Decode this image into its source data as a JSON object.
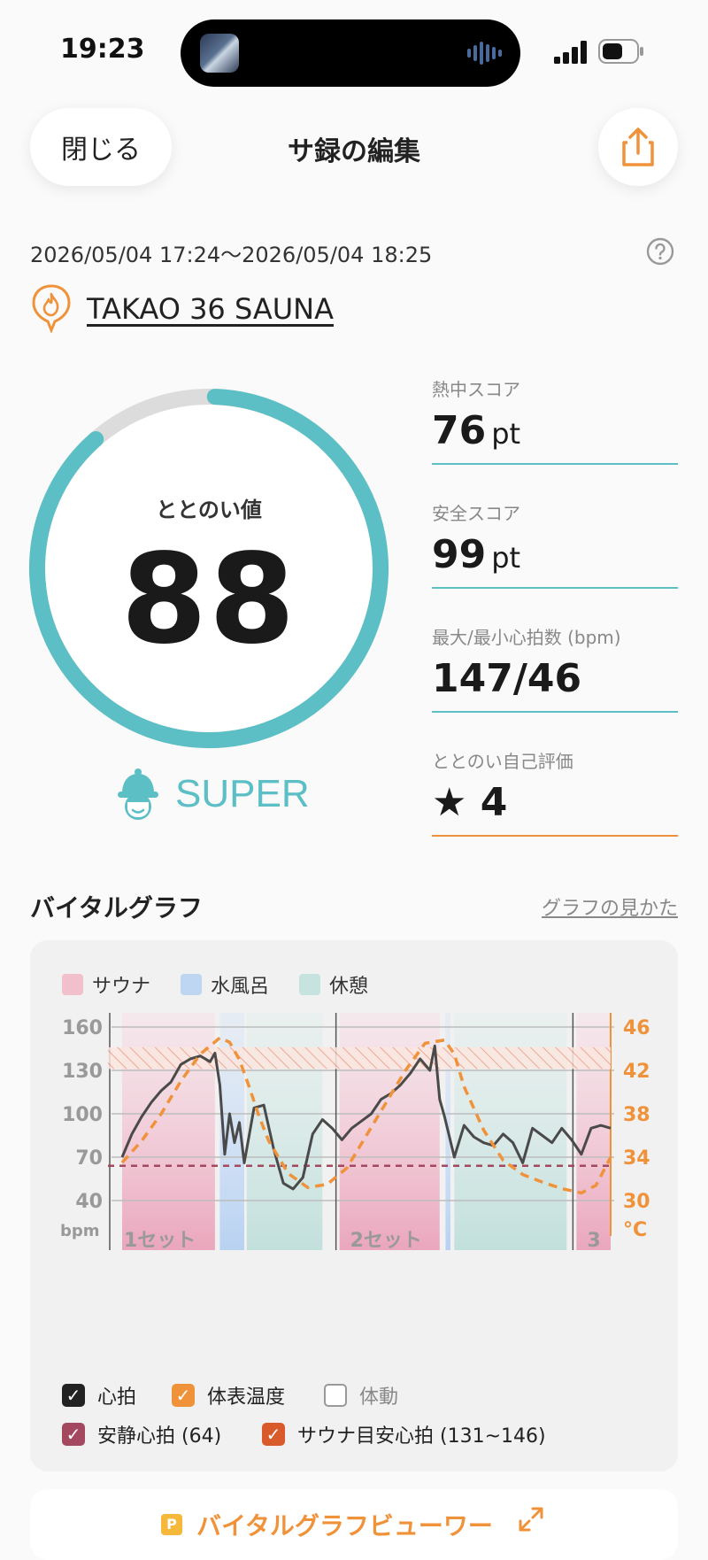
{
  "status_bar": {
    "time": "19:23"
  },
  "header": {
    "close_label": "閉じる",
    "title": "サ録の編集"
  },
  "session": {
    "datetime": "2026/05/04 17:24～2026/05/04 18:25",
    "location": "TAKAO 36 SAUNA"
  },
  "totonoi": {
    "label": "ととのい値",
    "value": "88",
    "rank": "SUPER",
    "gauge_fraction": 0.88
  },
  "metrics": [
    {
      "label": "熱中スコア",
      "value": "76",
      "unit": "pt"
    },
    {
      "label": "安全スコア",
      "value": "99",
      "unit": "pt"
    },
    {
      "label": "最大/最小心拍数 (bpm)",
      "value": "147/46",
      "unit": ""
    },
    {
      "label": "ととのい自己評価",
      "value": "★ 4",
      "unit": ""
    }
  ],
  "graph": {
    "title": "バイタルグラフ",
    "help_link": "グラフの見かた",
    "legend": [
      {
        "label": "サウナ",
        "color": "#f2bfcd"
      },
      {
        "label": "水風呂",
        "color": "#bfd6f2"
      },
      {
        "label": "休憩",
        "color": "#c6e3df"
      }
    ],
    "checkboxes": [
      {
        "label": "心拍",
        "checked": true,
        "color": "#222222"
      },
      {
        "label": "体表温度",
        "checked": true,
        "color": "#f0923a"
      },
      {
        "label": "体動",
        "checked": false,
        "color": "#999999"
      },
      {
        "label": "安静心拍 (64)",
        "checked": true,
        "color": "#a3485e"
      },
      {
        "label": "サウナ目安心拍 (131~146)",
        "checked": true,
        "color": "#d95b2b"
      }
    ]
  },
  "chart_data": {
    "type": "line",
    "y_left": {
      "ticks": [
        "160",
        "130",
        "100",
        "70",
        "40"
      ],
      "unit": "bpm",
      "range": [
        40,
        160
      ]
    },
    "y_right": {
      "ticks": [
        "46",
        "42",
        "38",
        "34",
        "30"
      ],
      "unit": "°C",
      "range": [
        30,
        46
      ]
    },
    "set_labels": [
      "1セット",
      "2セット",
      "3"
    ],
    "resting_hr": 64,
    "sauna_target_hr": [
      131,
      146
    ],
    "phases": [
      {
        "type": "sauna",
        "start": 0,
        "end": 0.19
      },
      {
        "type": "cold",
        "start": 0.2,
        "end": 0.25
      },
      {
        "type": "rest",
        "start": 0.255,
        "end": 0.41
      },
      {
        "type": "sauna",
        "start": 0.445,
        "end": 0.65
      },
      {
        "type": "cold",
        "start": 0.662,
        "end": 0.672
      },
      {
        "type": "rest",
        "start": 0.68,
        "end": 0.91
      },
      {
        "type": "sauna",
        "start": 0.93,
        "end": 1.0
      }
    ],
    "series": [
      {
        "name": "心拍",
        "x": [
          0,
          0.02,
          0.04,
          0.06,
          0.08,
          0.1,
          0.12,
          0.14,
          0.16,
          0.18,
          0.19,
          0.2,
          0.21,
          0.22,
          0.23,
          0.24,
          0.25,
          0.27,
          0.29,
          0.31,
          0.33,
          0.35,
          0.37,
          0.39,
          0.41,
          0.43,
          0.45,
          0.47,
          0.49,
          0.51,
          0.53,
          0.55,
          0.57,
          0.59,
          0.61,
          0.63,
          0.64,
          0.65,
          0.66,
          0.67,
          0.68,
          0.7,
          0.72,
          0.74,
          0.76,
          0.78,
          0.8,
          0.82,
          0.84,
          0.86,
          0.88,
          0.9,
          0.92,
          0.94,
          0.96,
          0.98,
          1.0
        ],
        "values": [
          70,
          86,
          98,
          108,
          116,
          122,
          134,
          138,
          140,
          136,
          142,
          120,
          72,
          100,
          80,
          94,
          66,
          104,
          106,
          76,
          52,
          48,
          56,
          86,
          96,
          90,
          82,
          90,
          95,
          100,
          110,
          114,
          120,
          128,
          138,
          130,
          147,
          110,
          98,
          84,
          70,
          92,
          84,
          80,
          78,
          86,
          80,
          66,
          90,
          85,
          80,
          90,
          82,
          72,
          90,
          92,
          90
        ]
      },
      {
        "name": "体表温度",
        "x": [
          0,
          0.04,
          0.08,
          0.12,
          0.16,
          0.2,
          0.22,
          0.24,
          0.26,
          0.28,
          0.3,
          0.34,
          0.38,
          0.42,
          0.46,
          0.5,
          0.54,
          0.58,
          0.62,
          0.66,
          0.68,
          0.7,
          0.74,
          0.78,
          0.82,
          0.86,
          0.9,
          0.94,
          0.97,
          1.0
        ],
        "values": [
          33.5,
          35.5,
          38,
          41,
          43.5,
          45,
          44.6,
          43,
          40.5,
          37.8,
          35.5,
          32.5,
          31.2,
          31.5,
          33,
          36,
          39,
          42,
          44.5,
          44.8,
          43.5,
          40.5,
          36.5,
          33.7,
          32.4,
          31.7,
          31.1,
          30.7,
          31.4,
          34
        ]
      }
    ]
  }
}
